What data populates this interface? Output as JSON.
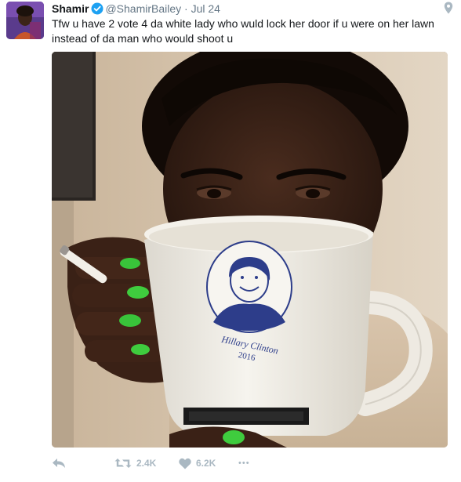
{
  "tweet": {
    "display_name": "Shamir",
    "handle": "@ShamirBailey",
    "separator": "·",
    "timestamp": "Jul 24",
    "text": "Tfw u have 2 vote 4 da white lady who wuld lock her door if u were on her lawn instead of da man who would shoot u",
    "mug_print": {
      "line1": "Hillary Clinton",
      "line2": "2016"
    }
  },
  "actions": {
    "retweet_count": "2.4K",
    "like_count": "6.2K",
    "more_label": "•••"
  },
  "icons": {
    "verified": "verified-badge-icon",
    "geo": "location-pin-icon",
    "reply": "reply-icon",
    "retweet": "retweet-icon",
    "like": "heart-icon",
    "more": "more-dots-icon"
  },
  "colors": {
    "verified_blue": "#1da1f2",
    "meta_gray": "#657786",
    "action_gray": "#aab8c2"
  }
}
